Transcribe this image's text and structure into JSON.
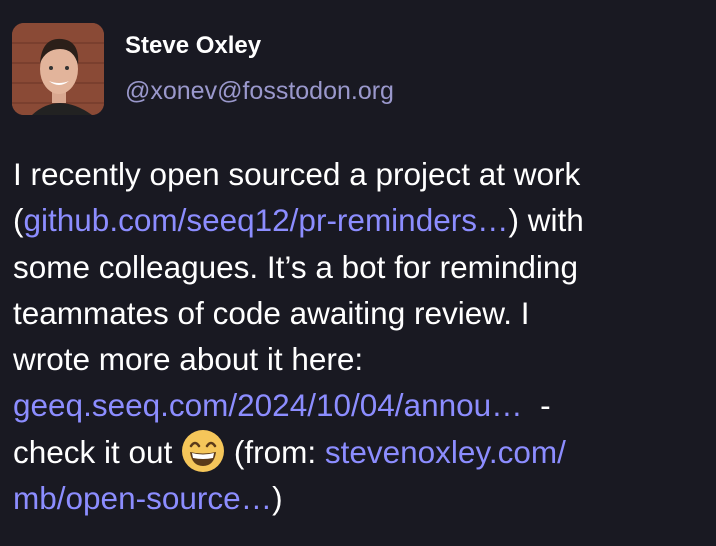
{
  "post": {
    "author": {
      "display_name": "Steve Oxley",
      "handle": "@xonev@fosstodon.org",
      "avatar_icon": "avatar-photo"
    },
    "content": {
      "l1": "I recently open sourced a project at work",
      "l2_open": "(",
      "link1": "github.com/seeq12/pr-reminders…",
      "l2_close": ") with",
      "l3": "some colleagues. It’s a bot for reminding",
      "l4": "teammates of code awaiting review. I",
      "l5": "wrote more about it here:",
      "link2": "geeq.seeq.com/2024/10/04/annou…",
      "l6_tail": "  -",
      "l7_a": "check it out ",
      "emoji": "grinning-face-with-smiling-eyes",
      "l7_b": " (from: ",
      "link3a": "stevenoxley.com/",
      "link3b": "mb/open-source…",
      "l8_close": ")"
    },
    "colors": {
      "background": "#191922",
      "link": "#8c8dff",
      "handle": "#9a98cc",
      "text": "#ffffff"
    }
  }
}
